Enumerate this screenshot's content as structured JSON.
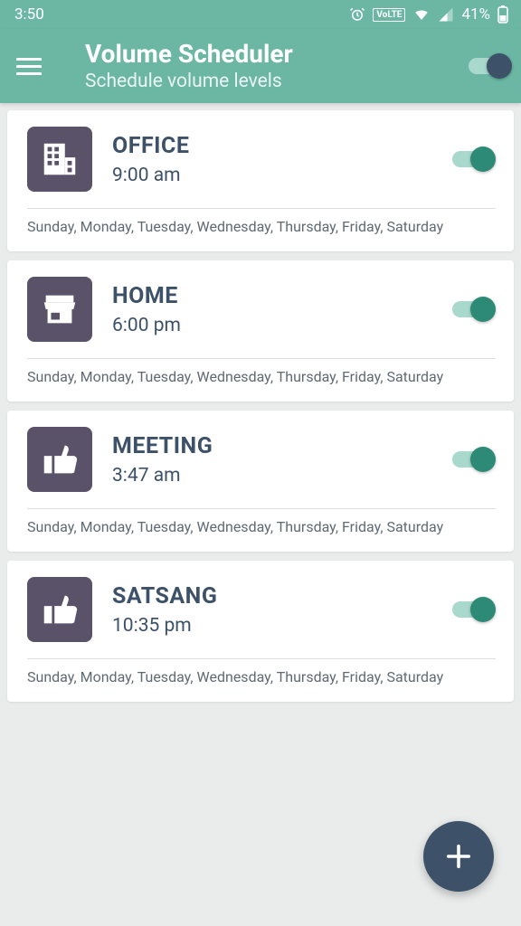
{
  "statusbar": {
    "time": "3:50",
    "battery": "41%"
  },
  "appbar": {
    "title": "Volume Scheduler",
    "subtitle": "Schedule volume levels"
  },
  "schedules": [
    {
      "title": "OFFICE",
      "time": "9:00 am",
      "days": "Sunday, Monday, Tuesday, Wednesday, Thursday, Friday, Saturday",
      "icon": "building"
    },
    {
      "title": "HOME",
      "time": "6:00 pm",
      "days": "Sunday, Monday, Tuesday, Wednesday, Thursday, Friday, Saturday",
      "icon": "store"
    },
    {
      "title": "MEETING",
      "time": "3:47 am",
      "days": "Sunday, Monday, Tuesday, Wednesday, Thursday, Friday, Saturday",
      "icon": "thumb"
    },
    {
      "title": "SATSANG",
      "time": "10:35 pm",
      "days": "Sunday, Monday, Tuesday, Wednesday, Thursday, Friday, Saturday",
      "icon": "thumb"
    }
  ]
}
